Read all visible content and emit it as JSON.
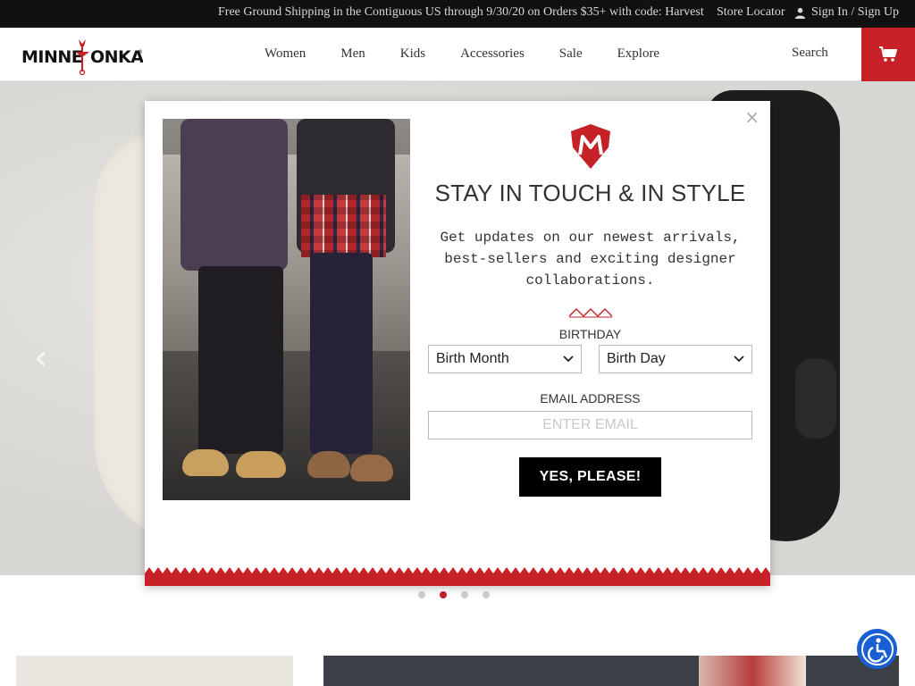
{
  "promo": {
    "text": "Free Ground Shipping in the Contiguous US through 9/30/20 on Orders $35+ with code: Harvest",
    "store_locator": "Store Locator",
    "signin": "Sign In / Sign Up"
  },
  "header": {
    "logo_text": "MINNETONKA",
    "nav": [
      "Women",
      "Men",
      "Kids",
      "Accessories",
      "Sale",
      "Explore"
    ],
    "search_label": "Search",
    "cart_icon": "cart-icon",
    "brand_color": "#c52127"
  },
  "hero": {
    "arrow": "‹",
    "slide_count": 4,
    "active_slide": 2
  },
  "modal": {
    "close": "×",
    "title": "STAY IN TOUCH & IN STYLE",
    "description": "Get updates on our newest arrivals, best-sellers and exciting designer collaborations.",
    "birthday_label": "BIRTHDAY",
    "birth_month": "Birth Month",
    "birth_day": "Birth Day",
    "email_label": "EMAIL ADDRESS",
    "email_placeholder": "ENTER EMAIL",
    "submit_label": "YES, PLEASE!"
  },
  "accessibility": {
    "icon": "accessibility-icon",
    "color": "#1a5fd1"
  }
}
